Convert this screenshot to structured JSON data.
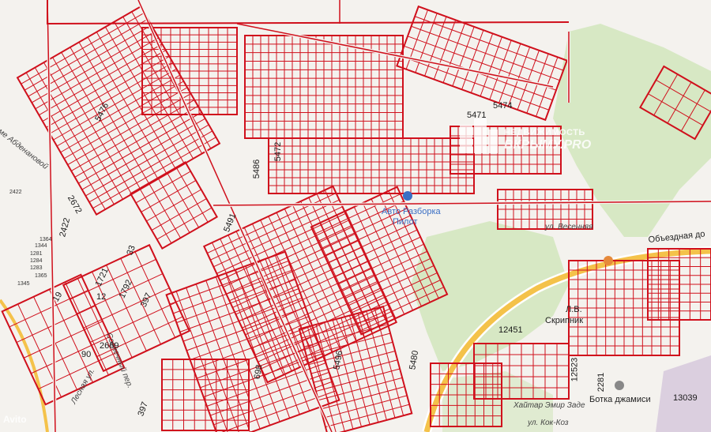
{
  "map": {
    "colors": {
      "parcel_line": "#d0101c",
      "background": "#f4f2ee",
      "green": "#d7e8c4",
      "road": "#f4c24a",
      "poi": "#3a6fc4",
      "poi_orange": "#e6893a",
      "grey_pin": "#888888"
    },
    "parcel_labels": [
      "5476",
      "5471",
      "5474",
      "5472",
      "5486",
      "5491",
      "2672",
      "2422",
      "2422",
      "33",
      "1721",
      "1792",
      "397",
      "19",
      "12",
      "90",
      "2669",
      "698",
      "5496",
      "5480",
      "12451",
      "12523",
      "2281",
      "13039",
      "397",
      "1345",
      "1281",
      "1284",
      "1283",
      "1344",
      "1365",
      "1364"
    ],
    "street_labels": [
      "Алиме Абденановой",
      "Солнечный пер.",
      "Лесная ул.",
      "Хайтар Эмир Заде",
      "ул. Кок-Коз",
      "ул. Весенняя"
    ],
    "road_label": "Объездная до",
    "poi": {
      "auto_name": "Авто Разборка",
      "auto_sub": "Пилот",
      "lv": "Л.В.",
      "skripnik": "Скрипник",
      "mosque": "Ботка джамиси"
    },
    "watermark": {
      "line1": "НЕДВИЖИМОСТЬ",
      "line2": "ВКРЫМУ.PRO",
      "icon": "building-icon"
    },
    "corner_logo": "Avito"
  }
}
